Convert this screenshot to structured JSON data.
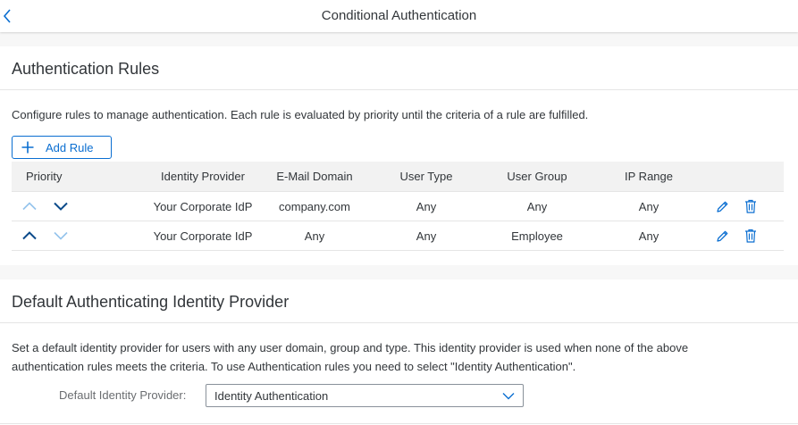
{
  "header": {
    "title": "Conditional Authentication",
    "back_icon": "chevron-left-icon"
  },
  "rules_section": {
    "title": "Authentication Rules",
    "description": "Configure rules to manage authentication. Each rule is evaluated by priority until the criteria of a rule are fulfilled.",
    "add_button_label": "Add Rule",
    "columns": [
      "Priority",
      "Identity Provider",
      "E-Mail Domain",
      "User Type",
      "User Group",
      "IP Range"
    ],
    "rows": [
      {
        "priority_up_enabled": false,
        "priority_down_enabled": true,
        "identity_provider": "Your Corporate IdP",
        "email_domain": "company.com",
        "user_type": "Any",
        "user_group": "Any",
        "ip_range": "Any"
      },
      {
        "priority_up_enabled": true,
        "priority_down_enabled": false,
        "identity_provider": "Your Corporate IdP",
        "email_domain": "Any",
        "user_type": "Any",
        "user_group": "Employee",
        "ip_range": "Any"
      }
    ]
  },
  "default_section": {
    "title": "Default Authenticating Identity Provider",
    "description_line1": "Set a default identity provider for users with any user domain, group and type. This identity provider is used when none of the above",
    "description_line2": "authentication rules meets the criteria. To use Authentication rules you need to select \"Identity Authentication\".",
    "field_label": "Default Identity Provider:",
    "selected_value": "Identity Authentication"
  },
  "colors": {
    "accent": "#0a6ed1",
    "text": "#32363a",
    "background": "#f7f7f7",
    "disabled_icon": "#94c3ec"
  }
}
